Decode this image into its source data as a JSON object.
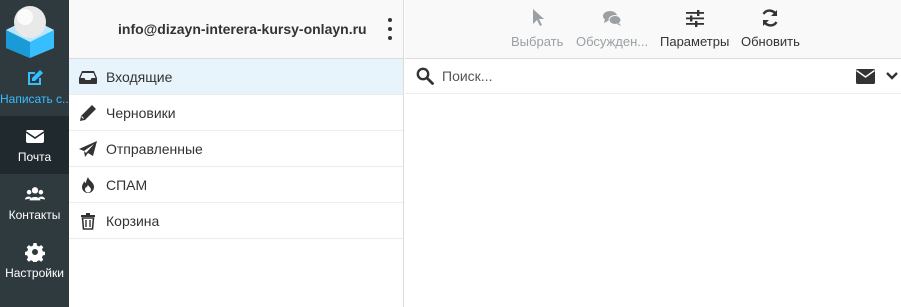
{
  "taskbar": {
    "items": [
      {
        "label": "Написать с...",
        "icon": "compose-icon",
        "state": "accent"
      },
      {
        "label": "Почта",
        "icon": "envelope-icon",
        "state": "selected"
      },
      {
        "label": "Контакты",
        "icon": "users-icon",
        "state": "normal"
      },
      {
        "label": "Настройки",
        "icon": "gear-icon",
        "state": "normal"
      }
    ],
    "accent_color": "#37beff",
    "background": "#2f3a3f"
  },
  "account": {
    "email": "info@dizayn-interera-kursy-onlayn.ru"
  },
  "folders": [
    {
      "label": "Входящие",
      "icon": "inbox-icon",
      "selected": true
    },
    {
      "label": "Черновики",
      "icon": "pencil-icon",
      "selected": false
    },
    {
      "label": "Отправленные",
      "icon": "paper-plane-icon",
      "selected": false
    },
    {
      "label": "СПАМ",
      "icon": "fire-icon",
      "selected": false
    },
    {
      "label": "Корзина",
      "icon": "trash-icon",
      "selected": false
    }
  ],
  "toolbar": {
    "select_label": "Выбрать",
    "discussion_label": "Обсужден...",
    "settings_label": "Параметры",
    "refresh_label": "Обновить"
  },
  "search": {
    "placeholder": "Поиск..."
  }
}
